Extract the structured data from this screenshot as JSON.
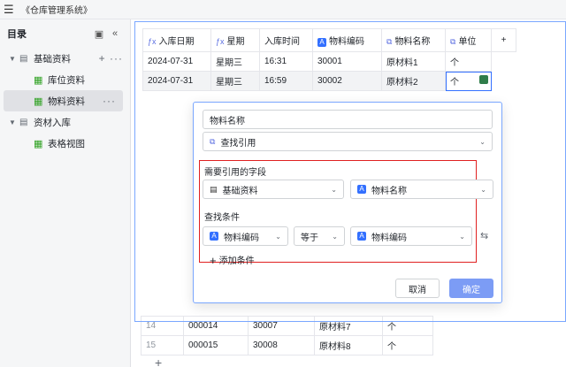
{
  "app": {
    "title": "《仓库管理系统》"
  },
  "sidebar": {
    "title": "目录",
    "groups": [
      {
        "label": "基础资料",
        "items": [
          {
            "label": "库位资料"
          },
          {
            "label": "物料资料"
          }
        ]
      },
      {
        "label": "资材入库",
        "items": [
          {
            "label": "表格视图"
          }
        ]
      }
    ]
  },
  "grid": {
    "columns": [
      "入库日期",
      "星期",
      "入库时间",
      "物料编码",
      "物料名称",
      "单位"
    ],
    "rows": [
      [
        "2024-07-31",
        "星期三",
        "16:31",
        "30001",
        "原材料1",
        "个"
      ],
      [
        "2024-07-31",
        "星期三",
        "16:59",
        "30002",
        "原材料2",
        "个"
      ]
    ],
    "lower_rows": [
      [
        "14",
        "000014",
        "30007",
        "原材料7",
        "个"
      ],
      [
        "15",
        "000015",
        "30008",
        "原材料8",
        "个"
      ]
    ]
  },
  "popup": {
    "field_name": "物料名称",
    "field_type": "查找引用",
    "ref_section_label": "需要引用的字段",
    "ref_table": "基础资料",
    "ref_field": "物料名称",
    "cond_section_label": "查找条件",
    "cond_field": "物料编码",
    "cond_op": "等于",
    "cond_value": "物料编码",
    "add_condition": "添加条件",
    "cancel": "取消",
    "confirm": "确定"
  },
  "colors": {
    "accent": "#3370ff",
    "highlight_box": "#e02020",
    "confirm_btn": "#7c9cf5"
  },
  "icons": {
    "formula": "formula-icon",
    "text": "text-field-icon",
    "lookup": "lookup-icon",
    "table": "table-icon",
    "grid": "grid-view-icon"
  }
}
